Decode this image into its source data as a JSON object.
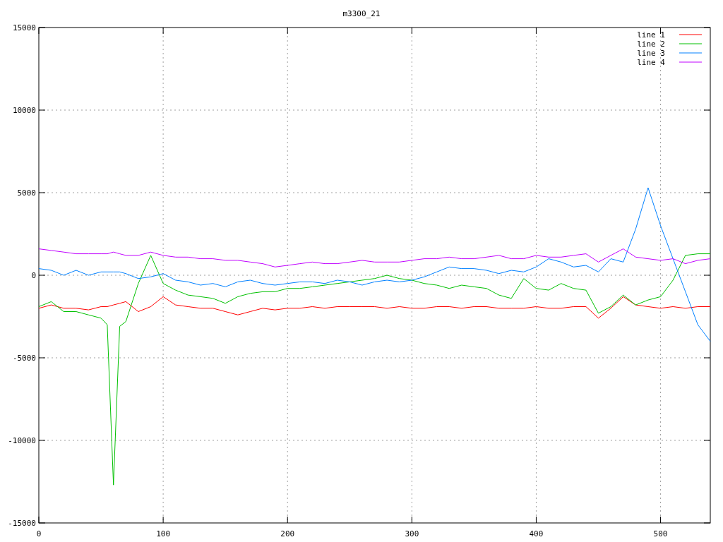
{
  "chart": {
    "chart_data": {
      "type": "line",
      "title": "m3300_21",
      "x": [
        0,
        10,
        20,
        30,
        40,
        50,
        55,
        60,
        65,
        70,
        80,
        90,
        100,
        110,
        120,
        130,
        140,
        150,
        160,
        170,
        180,
        190,
        200,
        210,
        220,
        230,
        240,
        250,
        260,
        270,
        280,
        290,
        300,
        310,
        320,
        330,
        340,
        350,
        360,
        370,
        380,
        390,
        400,
        410,
        420,
        430,
        440,
        450,
        460,
        470,
        480,
        490,
        500,
        510,
        520,
        530,
        540
      ],
      "series": [
        {
          "name": "line 1",
          "color": "#ff0000",
          "values": [
            -2000,
            -1800,
            -2000,
            -2000,
            -2100,
            -1900,
            -1900,
            -1800,
            -1700,
            -1600,
            -2200,
            -1900,
            -1300,
            -1800,
            -1900,
            -2000,
            -2000,
            -2200,
            -2400,
            -2200,
            -2000,
            -2100,
            -2000,
            -2000,
            -1900,
            -2000,
            -1900,
            -1900,
            -1900,
            -1900,
            -2000,
            -1900,
            -2000,
            -2000,
            -1900,
            -1900,
            -2000,
            -1900,
            -1900,
            -2000,
            -2000,
            -2000,
            -1900,
            -2000,
            -2000,
            -1900,
            -1900,
            -2600,
            -2000,
            -1300,
            -1800,
            -1900,
            -2000,
            -1900,
            -2000,
            -1900,
            -1900
          ]
        },
        {
          "name": "line 2",
          "color": "#00c000",
          "values": [
            -1900,
            -1600,
            -2200,
            -2200,
            -2400,
            -2600,
            -3000,
            -12700,
            -3100,
            -2800,
            -500,
            1200,
            -500,
            -900,
            -1200,
            -1300,
            -1400,
            -1700,
            -1300,
            -1100,
            -1000,
            -1000,
            -800,
            -800,
            -700,
            -600,
            -500,
            -400,
            -300,
            -200,
            0,
            -200,
            -300,
            -500,
            -600,
            -800,
            -600,
            -700,
            -800,
            -1200,
            -1400,
            -200,
            -800,
            -900,
            -500,
            -800,
            -900,
            -2300,
            -1900,
            -1200,
            -1800,
            -1500,
            -1300,
            -300,
            1200,
            1300,
            1300
          ]
        },
        {
          "name": "line 3",
          "color": "#0080ff",
          "values": [
            400,
            300,
            0,
            300,
            0,
            200,
            200,
            200,
            200,
            100,
            -200,
            -100,
            100,
            -300,
            -400,
            -600,
            -500,
            -700,
            -400,
            -300,
            -500,
            -600,
            -500,
            -400,
            -400,
            -500,
            -300,
            -400,
            -600,
            -400,
            -300,
            -400,
            -300,
            -100,
            200,
            500,
            400,
            400,
            300,
            100,
            300,
            200,
            500,
            1000,
            800,
            500,
            600,
            200,
            1000,
            800,
            2800,
            5300,
            3000,
            1000,
            -1000,
            -3000,
            -4000
          ]
        },
        {
          "name": "line 4",
          "color": "#c000ff",
          "values": [
            1600,
            1500,
            1400,
            1300,
            1300,
            1300,
            1300,
            1400,
            1300,
            1200,
            1200,
            1400,
            1200,
            1100,
            1100,
            1000,
            1000,
            900,
            900,
            800,
            700,
            500,
            600,
            700,
            800,
            700,
            700,
            800,
            900,
            800,
            800,
            800,
            900,
            1000,
            1000,
            1100,
            1000,
            1000,
            1100,
            1200,
            1000,
            1000,
            1200,
            1100,
            1100,
            1200,
            1300,
            800,
            1200,
            1600,
            1100,
            1000,
            900,
            1000,
            700,
            900,
            1000
          ]
        }
      ],
      "grid": true,
      "legend": true,
      "xlim": [
        0,
        540
      ],
      "ylim": [
        -15000,
        15000
      ],
      "xticks": [
        0,
        100,
        200,
        300,
        400,
        500
      ],
      "yticks": [
        -15000,
        -10000,
        -5000,
        0,
        5000,
        10000,
        15000
      ]
    }
  }
}
